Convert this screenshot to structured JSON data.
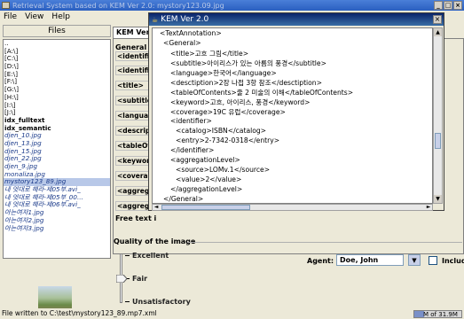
{
  "window": {
    "title": "Retrieval System based on KEM Ver 2.0: mystory123.09.jpg"
  },
  "menu": [
    "File",
    "View",
    "Help"
  ],
  "left": {
    "header": "Files",
    "files": [
      "..",
      "[A:\\]",
      "[C:\\]",
      "[D:\\]",
      "[E:\\]",
      "[F:\\]",
      "[G:\\]",
      "[H:\\]",
      "[I:\\]",
      "[J:\\]",
      "idx_fulltext",
      "idx_semantic",
      "djen_10.jpg",
      "djen_13.jpg",
      "djen_15.jpg",
      "djen_22.jpg",
      "djen_9.jpg",
      "monaliza.jpg",
      "mystory123_89.jpg",
      "내 엇대로 해라-제05부.avi_",
      "내 엇대로 해라-제05부_00...",
      "내 엇대로 해라-제06부.avi_",
      "아는여자1.jpg",
      "아는여자2.jpg",
      "아는여자3.jpg"
    ],
    "selected_index": 18
  },
  "right": {
    "tab_label": "KEM Ver 2",
    "general_label": "General",
    "fields": [
      "<identifier>",
      "<identifier>",
      "<title>",
      "<subtitle>",
      "<language>",
      "<description>",
      "<tableOfContents>",
      "<keyword>",
      "<coverage>",
      "<aggregationLevel>",
      "<aggregationLevel>"
    ],
    "freetext_label": "Free text i",
    "quality": {
      "title": "Quality of the image",
      "excellent": "Excellent",
      "fair": "Fair",
      "unsatisfactory": "Unsatisfactory",
      "agent_label": "Agent:",
      "agent_value": "Doe, John",
      "include_label": "Include DS"
    }
  },
  "dialog": {
    "title": "KEM Ver 2.0",
    "lines": [
      "<TextAnnotation>",
      "<General>",
      "<title>고흐 그림</title>",
      "<subtitle>아이리스가 있는 아름의 풍경</subtitle>",
      "<language>한국어</language>",
      "<desctiption>2장 나접 3항 참조</desctiption>",
      "<tableOfContents>줄 2 미술의 이해</tableOfContents>",
      "<keyword>고흐, 아이리스, 풍경</keyword>",
      "<coverage>19C 유럽</coverage>",
      "<identifier>",
      "<catalog>ISBN</catalog>",
      "<entry>2-7342-0318</entry>",
      "</identifier>",
      "<aggregationLevel>",
      "<source>LOMv.1</source>",
      "<value>2</value>",
      "</aggregationLevel>",
      "</General>"
    ]
  },
  "status": {
    "text": "File written to C:\\test\\mystory123_89.mp7.xml",
    "memory": "M of 31.9M",
    "memory_fraction": 0.2
  }
}
